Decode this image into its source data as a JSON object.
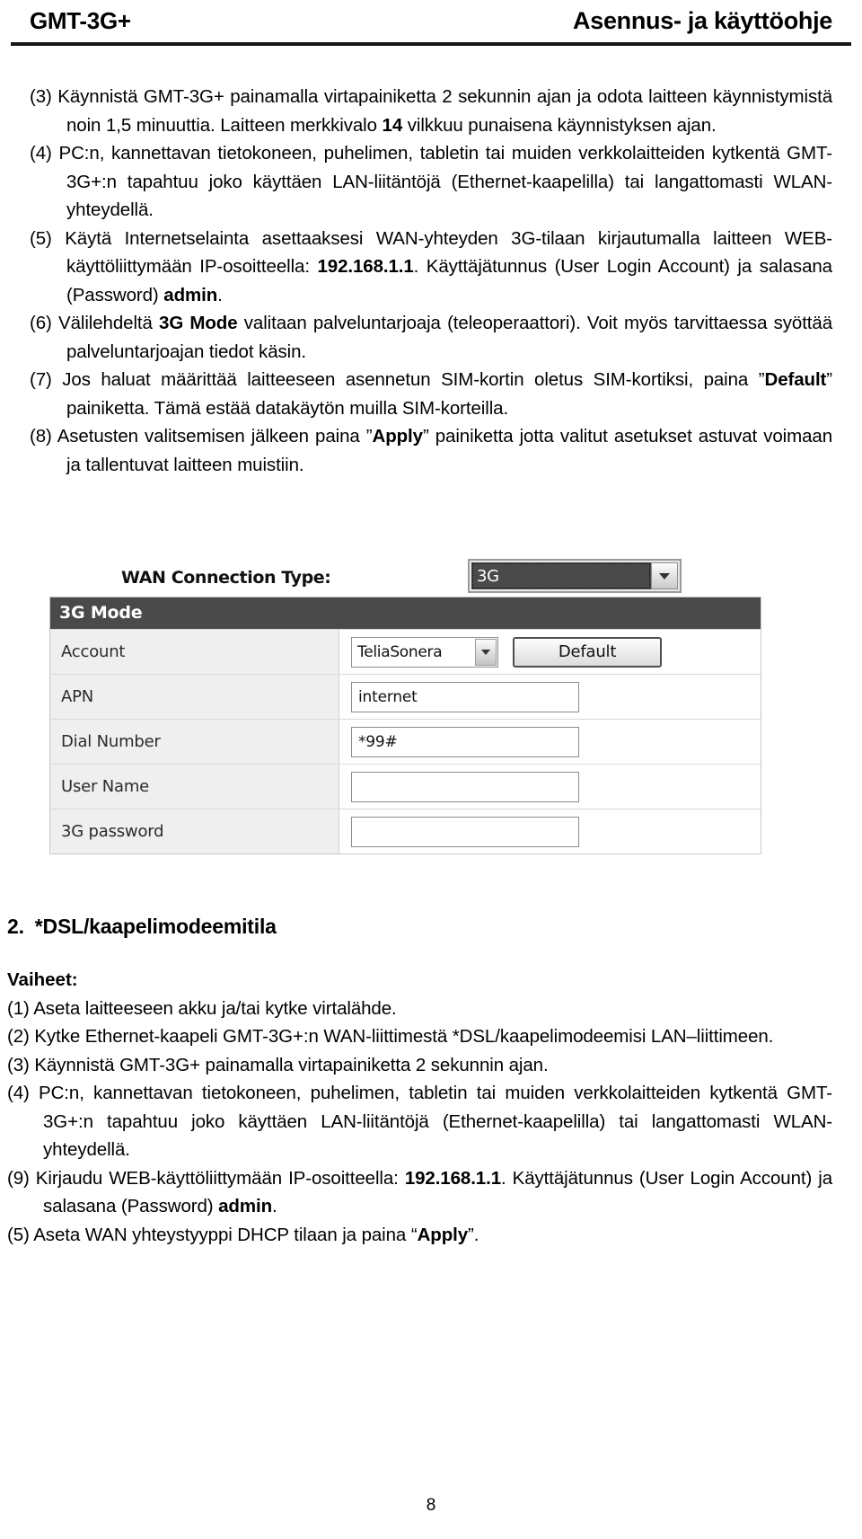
{
  "header": {
    "left_title": "GMT-3G+",
    "right_title": "Asennus- ja käyttöohje"
  },
  "section1": {
    "items": [
      {
        "marker": "(3)",
        "parts": [
          {
            "t": "Käynnistä GMT-3G+ painamalla virtapainiketta 2 sekunnin ajan ja odota laitteen käynnistymistä noin 1,5 minuuttia. Laitteen merkkivalo ",
            "b": false
          },
          {
            "t": "14",
            "b": true
          },
          {
            "t": " vilkkuu punaisena käynnistyksen ajan.",
            "b": false
          }
        ]
      },
      {
        "marker": "(4)",
        "parts": [
          {
            "t": "PC:n, kannettavan tietokoneen, puhelimen, tabletin tai muiden verkkolaitteiden kytkentä GMT-3G+:n tapahtuu joko käyttäen LAN-liitäntöjä (Ethernet-kaapelilla) tai langattomasti WLAN-yhteydellä.",
            "b": false
          }
        ]
      },
      {
        "marker": "(5)",
        "parts": [
          {
            "t": "Käytä Internetselainta asettaaksesi WAN-yhteyden 3G-tilaan kirjautumalla laitteen WEB-käyttöliittymään IP-osoitteella: ",
            "b": false
          },
          {
            "t": "192.168.1.1",
            "b": true
          },
          {
            "t": ". Käyttäjätunnus (User Login Account) ja salasana (Password) ",
            "b": false
          },
          {
            "t": "admin",
            "b": true
          },
          {
            "t": ".",
            "b": false
          }
        ]
      },
      {
        "marker": "(6)",
        "parts": [
          {
            "t": "Välilehdeltä ",
            "b": false
          },
          {
            "t": "3G Mode",
            "b": true
          },
          {
            "t": " valitaan palveluntarjoaja (teleoperaattori). Voit myös tarvittaessa syöttää palveluntarjoajan tiedot käsin.",
            "b": false
          }
        ]
      },
      {
        "marker": "(7)",
        "parts": [
          {
            "t": "Jos haluat määrittää laitteeseen asennetun SIM-kortin oletus SIM-kortiksi, paina ”",
            "b": false
          },
          {
            "t": "Default",
            "b": true
          },
          {
            "t": "” painiketta. Tämä estää datakäytön muilla SIM-korteilla.",
            "b": false
          }
        ]
      },
      {
        "marker": "(8)",
        "parts": [
          {
            "t": "Asetusten valitsemisen jälkeen paina ”",
            "b": false
          },
          {
            "t": "Apply",
            "b": true
          },
          {
            "t": "” painiketta jotta valitut asetukset astuvat voimaan ja tallentuvat laitteen muistiin.",
            "b": false
          }
        ]
      }
    ]
  },
  "router_ui": {
    "wan_connection_label": "WAN Connection Type:",
    "wan_connection_value": "3G",
    "panel_title": "3G Mode",
    "rows": [
      {
        "label": "Account",
        "control": "select",
        "value": "TeliaSonera",
        "button": "Default"
      },
      {
        "label": "APN",
        "control": "text",
        "value": "internet"
      },
      {
        "label": "Dial Number",
        "control": "text",
        "value": "*99#"
      },
      {
        "label": "User Name",
        "control": "text",
        "value": ""
      },
      {
        "label": "3G password",
        "control": "text",
        "value": ""
      }
    ]
  },
  "section2": {
    "number": "2.",
    "title": "*DSL/kaapelimodeemitila",
    "steps_label": "Vaiheet:",
    "items": [
      {
        "marker": "(1)",
        "parts": [
          {
            "t": "Aseta laitteeseen akku ja/tai kytke virtalähde.",
            "b": false
          }
        ]
      },
      {
        "marker": "(2)",
        "parts": [
          {
            "t": "Kytke Ethernet-kaapeli GMT-3G+:n WAN-liittimestä *DSL/kaapelimodeemisi LAN–liittimeen.",
            "b": false
          }
        ]
      },
      {
        "marker": "(3)",
        "parts": [
          {
            "t": "Käynnistä GMT-3G+ painamalla virtapainiketta 2 sekunnin ajan.",
            "b": false
          }
        ]
      },
      {
        "marker": "(4)",
        "parts": [
          {
            "t": "PC:n, kannettavan tietokoneen, puhelimen, tabletin tai muiden verkkolaitteiden kytkentä GMT-3G+:n tapahtuu joko käyttäen LAN-liitäntöjä (Ethernet-kaapelilla) tai langattomasti WLAN-yhteydellä.",
            "b": false
          }
        ]
      },
      {
        "marker": "(9)",
        "parts": [
          {
            "t": "Kirjaudu WEB-käyttöliittymään IP-osoitteella: ",
            "b": false
          },
          {
            "t": "192.168.1.1",
            "b": true
          },
          {
            "t": ". Käyttäjätunnus (User Login Account) ja salasana (Password) ",
            "b": false
          },
          {
            "t": "admin",
            "b": true
          },
          {
            "t": ".",
            "b": false
          }
        ]
      },
      {
        "marker": "(5)",
        "parts": [
          {
            "t": "Aseta WAN yhteystyyppi DHCP tilaan ja paina “",
            "b": false
          },
          {
            "t": "Apply",
            "b": true
          },
          {
            "t": "”.",
            "b": false
          }
        ]
      }
    ]
  },
  "footer": {
    "page_number": "8"
  },
  "colors": {
    "panel_header_bg": "#4a4a4a",
    "row_label_bg": "#efefef",
    "text": "#000000"
  }
}
